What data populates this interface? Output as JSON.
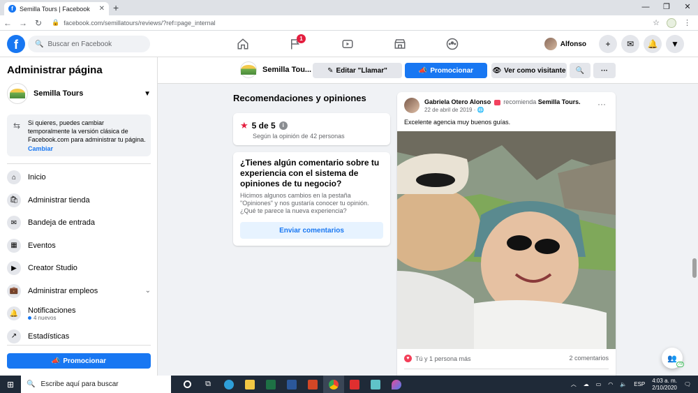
{
  "browser": {
    "tab_title": "Semilla Tours | Facebook",
    "tab_close": "✕",
    "new_tab": "+",
    "url": "facebook.com/semillatours/reviews/?ref=page_internal",
    "win_min": "—",
    "win_max": "❐",
    "win_close": "✕"
  },
  "topbar": {
    "search_placeholder": "Buscar en Facebook",
    "flag_badge": "1",
    "user_name": "Alfonso"
  },
  "sidebar": {
    "title": "Administrar página",
    "page_name": "Semilla Tours",
    "notice_text": "Si quieres, puedes cambiar temporalmente la versión clásica de Facebook.com para administrar tu página.",
    "notice_link": "Cambiar",
    "items": [
      {
        "label": "Inicio",
        "icon": "home-icon",
        "glyph": "⌂"
      },
      {
        "label": "Administrar tienda",
        "icon": "shop-icon",
        "glyph": "🛍"
      },
      {
        "label": "Bandeja de entrada",
        "icon": "inbox-icon",
        "glyph": "✉"
      },
      {
        "label": "Eventos",
        "icon": "calendar-icon",
        "glyph": "▦"
      },
      {
        "label": "Creator Studio",
        "icon": "clapper-icon",
        "glyph": "▶"
      },
      {
        "label": "Administrar empleos",
        "icon": "briefcase-icon",
        "glyph": "💼"
      },
      {
        "label": "Notificaciones",
        "icon": "bell-icon",
        "glyph": "🔔",
        "sub": "4 nuevos"
      },
      {
        "label": "Estadísticas",
        "icon": "chart-icon",
        "glyph": "↗"
      }
    ],
    "promote_label": "Promocionar"
  },
  "pagebar": {
    "page_name": "Semilla Tou...",
    "edit_call_label": "Editar \"Llamar\"",
    "promote_label": "Promocionar",
    "view_as_label": "Ver como visitante",
    "search_glyph": "🔍",
    "more_glyph": "···"
  },
  "reviews": {
    "section_title": "Recomendaciones y opiniones",
    "score": "5 de 5",
    "score_sub": "Según la opinión de 42 personas",
    "feedback_title": "¿Tienes algún comentario sobre tu experiencia con el sistema de opiniones de tu negocio?",
    "feedback_body": "Hicimos algunos cambios en la pestaña \"Opiniones\" y nos gustaría conocer tu opinión. ¿Qué te parece la nueva experiencia?",
    "feedback_button": "Enviar comentarios"
  },
  "post": {
    "author": "Gabriela Otero Alonso",
    "recommends": "recomienda",
    "target": "Semilla Tours.",
    "date": "22 de abril de 2019 · ",
    "text": "Excelente agencia muy buenos guías.",
    "reactions": "Tú y 1 persona más",
    "comments": "2 comentarios"
  },
  "chat": {
    "count": "78"
  },
  "taskbar": {
    "search_placeholder": "Escribe aquí para buscar",
    "lang": "ESP",
    "time": "4:03 a. m.",
    "date": "2/10/2020"
  },
  "colors": {
    "fb_blue": "#1877f2",
    "badge_red": "#e41e3f"
  }
}
